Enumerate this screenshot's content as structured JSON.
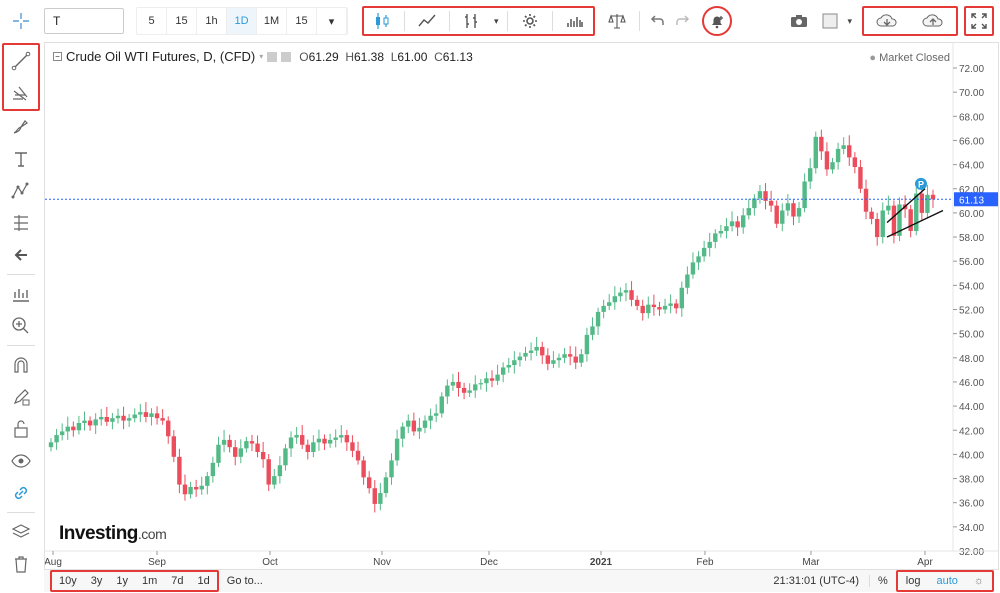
{
  "toolbar": {
    "symbol": "T",
    "timeframes": [
      "5",
      "15",
      "1h",
      "1D",
      "1M",
      "15"
    ],
    "active_timeframe": "1D"
  },
  "legend": {
    "title": "Crude Oil WTI Futures, D, (CFD)",
    "open_label": "O",
    "open": "61.29",
    "high_label": "H",
    "high": "61.38",
    "low_label": "L",
    "low": "61.00",
    "close_label": "C",
    "close": "61.13"
  },
  "status": {
    "market": "Market Closed"
  },
  "logo": {
    "main": "Investing",
    "suffix": ".com"
  },
  "price_axis": {
    "ticks": [
      "72.00",
      "70.00",
      "68.00",
      "66.00",
      "64.00",
      "62.00",
      "60.00",
      "58.00",
      "56.00",
      "54.00",
      "52.00",
      "50.00",
      "48.00",
      "46.00",
      "44.00",
      "42.00",
      "40.00",
      "38.00",
      "36.00",
      "34.00",
      "32.00"
    ],
    "last_price": "61.13"
  },
  "time_axis": {
    "labels": [
      "Aug",
      "Sep",
      "Oct",
      "Nov",
      "Dec",
      "2021",
      "Feb",
      "Mar",
      "Apr"
    ]
  },
  "bottom": {
    "ranges": [
      "10y",
      "3y",
      "1y",
      "1m",
      "7d",
      "1d"
    ],
    "goto": "Go to...",
    "clock": "21:31:01 (UTC-4)",
    "percent": "%",
    "log": "log",
    "auto": "auto"
  },
  "chart_data": {
    "type": "candlestick",
    "title": "Crude Oil WTI Futures, D, (CFD)",
    "ylim": [
      32,
      72
    ],
    "last": 61.13,
    "colors": {
      "up": "#53b987",
      "down": "#eb4d5c",
      "last_line": "#2962ff"
    },
    "closes": [
      41.0,
      41.6,
      41.9,
      42.3,
      42.0,
      42.6,
      42.8,
      42.4,
      42.9,
      43.1,
      42.7,
      43.0,
      43.2,
      42.8,
      43.0,
      43.3,
      43.5,
      43.1,
      43.4,
      43.0,
      42.8,
      41.5,
      39.8,
      37.5,
      36.7,
      37.3,
      37.1,
      37.4,
      38.2,
      39.3,
      40.8,
      41.2,
      40.6,
      39.8,
      40.5,
      41.1,
      40.9,
      40.2,
      39.6,
      37.5,
      38.2,
      39.1,
      40.5,
      41.4,
      41.6,
      40.8,
      40.2,
      41.0,
      41.3,
      40.9,
      41.2,
      41.4,
      41.6,
      41.0,
      40.3,
      39.5,
      38.1,
      37.2,
      35.9,
      36.8,
      38.1,
      39.5,
      41.3,
      42.3,
      42.8,
      41.9,
      42.2,
      42.8,
      43.2,
      43.4,
      44.8,
      45.7,
      46.0,
      45.5,
      45.1,
      45.3,
      45.8,
      45.9,
      46.3,
      46.1,
      46.6,
      47.2,
      47.4,
      47.8,
      48.1,
      48.4,
      48.6,
      48.9,
      48.2,
      47.5,
      47.8,
      48.0,
      48.3,
      48.1,
      47.6,
      48.3,
      49.9,
      50.6,
      51.8,
      52.3,
      52.6,
      53.1,
      53.4,
      53.6,
      52.8,
      52.3,
      51.7,
      52.4,
      52.2,
      52.0,
      52.3,
      52.5,
      52.1,
      53.8,
      54.9,
      55.9,
      56.4,
      57.1,
      57.6,
      58.3,
      58.5,
      58.9,
      59.3,
      58.8,
      59.8,
      60.4,
      61.2,
      61.8,
      61.0,
      60.6,
      59.1,
      60.2,
      60.8,
      59.7,
      60.4,
      62.6,
      63.7,
      66.3,
      65.1,
      63.6,
      64.2,
      65.3,
      65.6,
      64.6,
      63.8,
      62.0,
      60.1,
      59.5,
      58.0,
      60.2,
      60.6,
      58.1,
      60.7,
      60.3,
      58.5,
      61.6,
      60.0,
      61.5,
      61.13
    ]
  },
  "pattern_marker": "P"
}
